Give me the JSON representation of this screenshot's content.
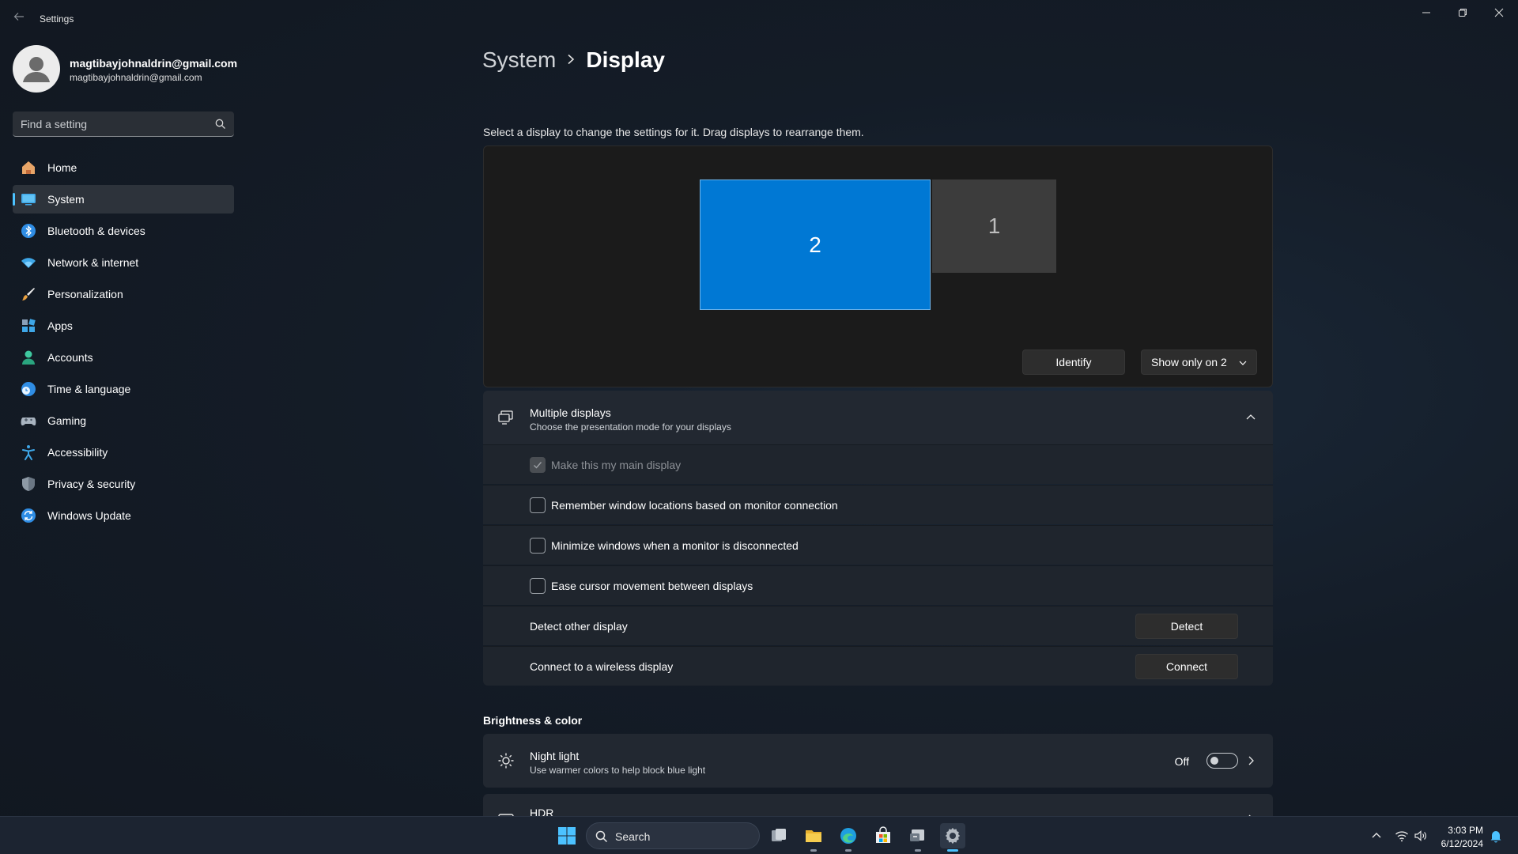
{
  "window": {
    "title": "Settings"
  },
  "profile": {
    "name": "magtibayjohnaldrin@gmail.com",
    "email": "magtibayjohnaldrin@gmail.com"
  },
  "search": {
    "placeholder": "Find a setting"
  },
  "sidebar": {
    "items": [
      {
        "label": "Home",
        "icon": "home-icon",
        "active": false
      },
      {
        "label": "System",
        "icon": "system-icon",
        "active": true
      },
      {
        "label": "Bluetooth & devices",
        "icon": "bluetooth-icon",
        "active": false
      },
      {
        "label": "Network & internet",
        "icon": "wifi-icon",
        "active": false
      },
      {
        "label": "Personalization",
        "icon": "brush-icon",
        "active": false
      },
      {
        "label": "Apps",
        "icon": "apps-icon",
        "active": false
      },
      {
        "label": "Accounts",
        "icon": "person-icon",
        "active": false
      },
      {
        "label": "Time & language",
        "icon": "globe-clock-icon",
        "active": false
      },
      {
        "label": "Gaming",
        "icon": "controller-icon",
        "active": false
      },
      {
        "label": "Accessibility",
        "icon": "accessibility-icon",
        "active": false
      },
      {
        "label": "Privacy & security",
        "icon": "shield-icon",
        "active": false
      },
      {
        "label": "Windows Update",
        "icon": "update-icon",
        "active": false
      }
    ]
  },
  "breadcrumb": {
    "parent": "System",
    "current": "Display"
  },
  "arrangement": {
    "instruction": "Select a display to change the settings for it. Drag displays to rearrange them.",
    "monitors": [
      {
        "number": "2",
        "selected": true
      },
      {
        "number": "1",
        "selected": false
      }
    ],
    "identify_label": "Identify",
    "show_only_label": "Show only on 2"
  },
  "multiple_displays": {
    "title": "Multiple displays",
    "subtitle": "Choose the presentation mode for your displays",
    "options": [
      {
        "label": "Make this my main display",
        "checked": true,
        "disabled": true
      },
      {
        "label": "Remember window locations based on monitor connection",
        "checked": false,
        "disabled": false
      },
      {
        "label": "Minimize windows when a monitor is disconnected",
        "checked": false,
        "disabled": false
      },
      {
        "label": "Ease cursor movement between displays",
        "checked": false,
        "disabled": false
      }
    ],
    "detect": {
      "label": "Detect other display",
      "button": "Detect"
    },
    "connect": {
      "label": "Connect to a wireless display",
      "button": "Connect"
    }
  },
  "brightness_color": {
    "heading": "Brightness & color",
    "night_light": {
      "title": "Night light",
      "subtitle": "Use warmer colors to help block blue light",
      "state": "Off"
    },
    "hdr": {
      "title": "HDR"
    }
  },
  "taskbar": {
    "search_label": "Search",
    "time": "3:03 PM",
    "date": "6/12/2024"
  },
  "colors": {
    "accent": "#0078d4",
    "accent_light": "#4cc2ff"
  }
}
